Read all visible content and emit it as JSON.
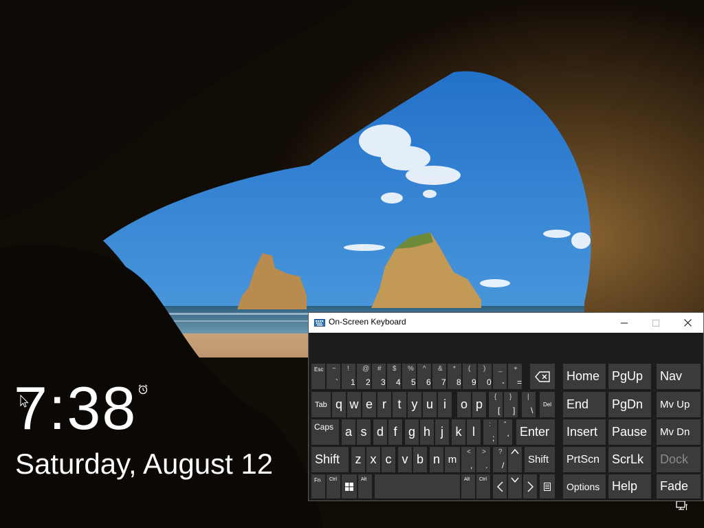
{
  "lockscreen": {
    "time": "7:38",
    "date": "Saturday, August 12"
  },
  "osk": {
    "title": "On-Screen Keyboard",
    "row1": [
      {
        "top": "",
        "main": "Esc"
      },
      {
        "top": "~",
        "main": "`"
      },
      {
        "top": "!",
        "main": "1"
      },
      {
        "top": "@",
        "main": "2"
      },
      {
        "top": "#",
        "main": "3"
      },
      {
        "top": "$",
        "main": "4"
      },
      {
        "top": "%",
        "main": "5"
      },
      {
        "top": "^",
        "main": "6"
      },
      {
        "top": "&",
        "main": "7"
      },
      {
        "top": "*",
        "main": "8"
      },
      {
        "top": "(",
        "main": "9"
      },
      {
        "top": ")",
        "main": "0"
      },
      {
        "top": "_",
        "main": "-"
      },
      {
        "top": "+",
        "main": "="
      }
    ],
    "row2_tab": "Tab",
    "row2": [
      "q",
      "w",
      "e",
      "r",
      "t",
      "y",
      "u",
      "i",
      "o",
      "p"
    ],
    "row2_brackets": [
      {
        "top": "{",
        "main": "["
      },
      {
        "top": "}",
        "main": "]"
      },
      {
        "top": "|",
        "main": "\\"
      }
    ],
    "row2_del": "Del",
    "row3_caps": "Caps",
    "row3": [
      "a",
      "s",
      "d",
      "f",
      "g",
      "h",
      "j",
      "k",
      "l"
    ],
    "row3_punct": [
      {
        "top": ":",
        "main": ";"
      },
      {
        "top": "\"",
        "main": "'"
      }
    ],
    "row3_enter": "Enter",
    "row4_shift": "Shift",
    "row4": [
      "z",
      "x",
      "c",
      "v",
      "b",
      "n",
      "m"
    ],
    "row4_punct": [
      {
        "top": "<",
        "main": ","
      },
      {
        "top": ">",
        "main": "."
      },
      {
        "top": "?",
        "main": "/"
      }
    ],
    "row4_shift_right": "Shift",
    "row5": {
      "fn": "Fn",
      "ctrl": "Ctrl",
      "alt": "Alt",
      "alt_right": "Alt",
      "ctrl_right": "Ctrl"
    },
    "nav_keys": {
      "home": "Home",
      "pgup": "PgUp",
      "end": "End",
      "pgdn": "PgDn",
      "insert": "Insert",
      "pause": "Pause",
      "prtscn": "PrtScn",
      "scrlk": "ScrLk",
      "options": "Options",
      "help": "Help"
    },
    "side_keys": {
      "nav": "Nav",
      "mvup": "Mv Up",
      "mvdn": "Mv Dn",
      "dock": "Dock",
      "fade": "Fade"
    }
  }
}
